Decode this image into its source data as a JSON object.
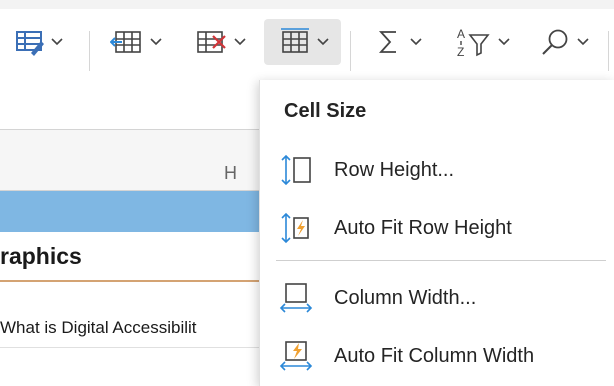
{
  "toolbar": {
    "tools": [
      {
        "name": "format-icon"
      },
      {
        "name": "insert-icon"
      },
      {
        "name": "delete-icon"
      },
      {
        "name": "cell-size-icon",
        "active": true
      },
      {
        "name": "sum-icon"
      },
      {
        "name": "sort-filter-icon"
      },
      {
        "name": "find-icon"
      }
    ]
  },
  "sheet": {
    "column_letter": "H",
    "row_graphics_text": "raphics",
    "row_digital_text": "What is Digital Accessibilit"
  },
  "menu": {
    "title": "Cell Size",
    "items": [
      {
        "label": "Row Height..."
      },
      {
        "label": "Auto Fit Row Height"
      },
      {
        "label": "Column Width..."
      },
      {
        "label": "Auto Fit Column Width"
      }
    ]
  },
  "colors": {
    "accent_blue": "#2b88d8",
    "selection_row": "#7fb7e3",
    "orange": "#f0a030",
    "delete_red": "#d13438"
  }
}
